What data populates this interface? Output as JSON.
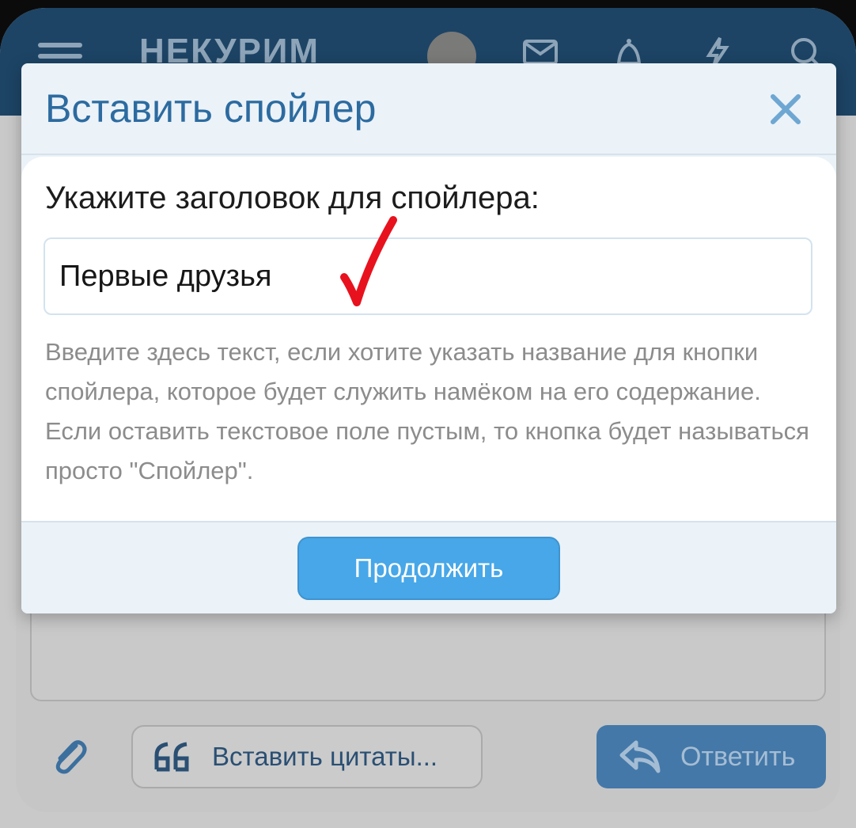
{
  "header": {
    "site_name": "НЕКУРИМ",
    "icons": [
      "menu-icon",
      "avatar",
      "mail-icon",
      "bell-icon",
      "lightning-icon",
      "search-icon"
    ]
  },
  "modal": {
    "title": "Вставить спойлер",
    "close_icon": "close-icon",
    "field_label": "Укажите заголовок для спойлера:",
    "input_value": "Первые друзья",
    "hint": "Введите здесь текст, если хотите указать название для кнопки спойлера, которое будет служить намёком на его содержание. Если оставить текстовое поле пустым, то кнопка будет называться просто \"Спойлер\".",
    "continue_label": "Продолжить",
    "annotation_color": "#e8121e",
    "accent_color": "#47a7e8"
  },
  "toolbar": {
    "attach_icon": "paperclip-icon",
    "quotes_label": "Вставить цитаты...",
    "reply_label": "Ответить"
  }
}
